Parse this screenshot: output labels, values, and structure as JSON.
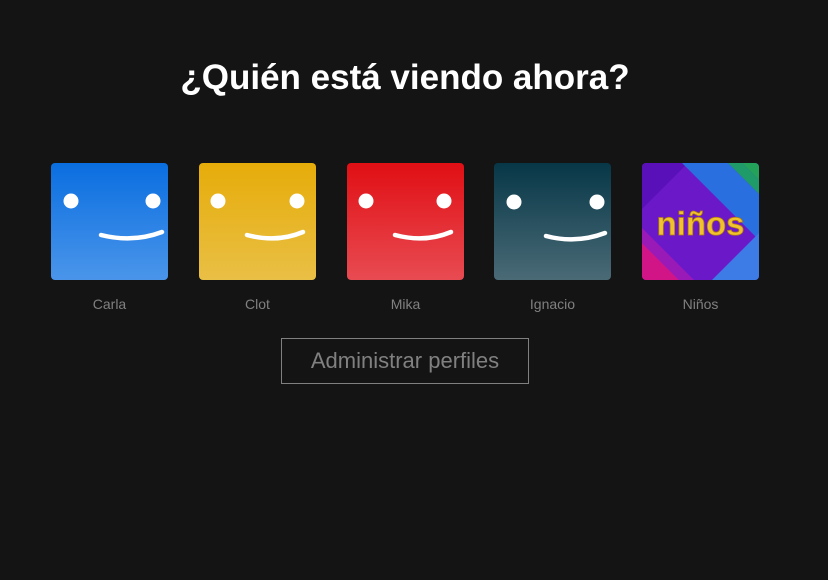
{
  "title": "¿Quién está viendo ahora?",
  "profiles": [
    {
      "name": "Carla",
      "avatar": "smiley-icon",
      "color_top": "#0a6ee0",
      "color_bottom": "#4a95ea"
    },
    {
      "name": "Clot",
      "avatar": "smiley-icon",
      "color_top": "#e6ac09",
      "color_bottom": "#e9bf45"
    },
    {
      "name": "Mika",
      "avatar": "smiley-icon",
      "color_top": "#e00f14",
      "color_bottom": "#e84b52"
    },
    {
      "name": "Ignacio",
      "avatar": "smiley-icon",
      "color_top": "#073747",
      "color_bottom": "#4a6a76"
    },
    {
      "name": "Niños",
      "avatar": "kids-logo",
      "logo_text": "niños"
    }
  ],
  "manage_button": "Administrar perfiles",
  "colors": {
    "background": "#141414",
    "title": "#ffffff",
    "muted": "#808080"
  }
}
